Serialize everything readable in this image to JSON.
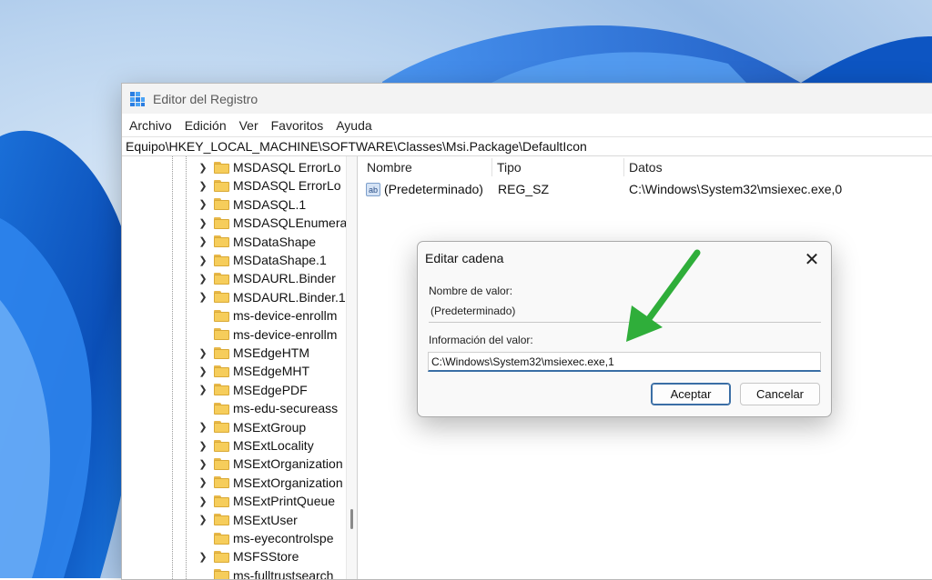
{
  "window": {
    "title": "Editor del Registro",
    "menu": [
      "Archivo",
      "Edición",
      "Ver",
      "Favoritos",
      "Ayuda"
    ],
    "address": "Equipo\\HKEY_LOCAL_MACHINE\\SOFTWARE\\Classes\\Msi.Package\\DefaultIcon"
  },
  "tree": {
    "items": [
      {
        "label": "MSDASQL ErrorLo",
        "expandable": true
      },
      {
        "label": "MSDASQL ErrorLo",
        "expandable": true
      },
      {
        "label": "MSDASQL.1",
        "expandable": true
      },
      {
        "label": "MSDASQLEnumera",
        "expandable": true
      },
      {
        "label": "MSDataShape",
        "expandable": true
      },
      {
        "label": "MSDataShape.1",
        "expandable": true
      },
      {
        "label": "MSDAURL.Binder",
        "expandable": true
      },
      {
        "label": "MSDAURL.Binder.1",
        "expandable": true
      },
      {
        "label": "ms-device-enrollm",
        "expandable": false
      },
      {
        "label": "ms-device-enrollm",
        "expandable": false
      },
      {
        "label": "MSEdgeHTM",
        "expandable": true
      },
      {
        "label": "MSEdgeMHT",
        "expandable": true
      },
      {
        "label": "MSEdgePDF",
        "expandable": true
      },
      {
        "label": "ms-edu-secureass",
        "expandable": false
      },
      {
        "label": "MSExtGroup",
        "expandable": true
      },
      {
        "label": "MSExtLocality",
        "expandable": true
      },
      {
        "label": "MSExtOrganization",
        "expandable": true
      },
      {
        "label": "MSExtOrganization",
        "expandable": true
      },
      {
        "label": "MSExtPrintQueue",
        "expandable": true
      },
      {
        "label": "MSExtUser",
        "expandable": true
      },
      {
        "label": "ms-eyecontrolspe",
        "expandable": false
      },
      {
        "label": "MSFSStore",
        "expandable": true
      },
      {
        "label": "ms-fulltrustsearch",
        "expandable": false
      }
    ]
  },
  "list": {
    "headers": {
      "name": "Nombre",
      "type": "Tipo",
      "data": "Datos"
    },
    "rows": [
      {
        "icon": "ab",
        "name": "(Predeterminado)",
        "type": "REG_SZ",
        "data": "C:\\Windows\\System32\\msiexec.exe,0"
      }
    ]
  },
  "dialog": {
    "title": "Editar cadena",
    "name_label": "Nombre de valor:",
    "name_value": "(Predeterminado)",
    "data_label": "Información del valor:",
    "data_value": "C:\\Windows\\System32\\msiexec.exe,1",
    "ok_label": "Aceptar",
    "cancel_label": "Cancelar"
  },
  "colors": {
    "accent": "#3a6ea5",
    "arrow": "#2fae3a",
    "folder": "#f6cd5b"
  }
}
